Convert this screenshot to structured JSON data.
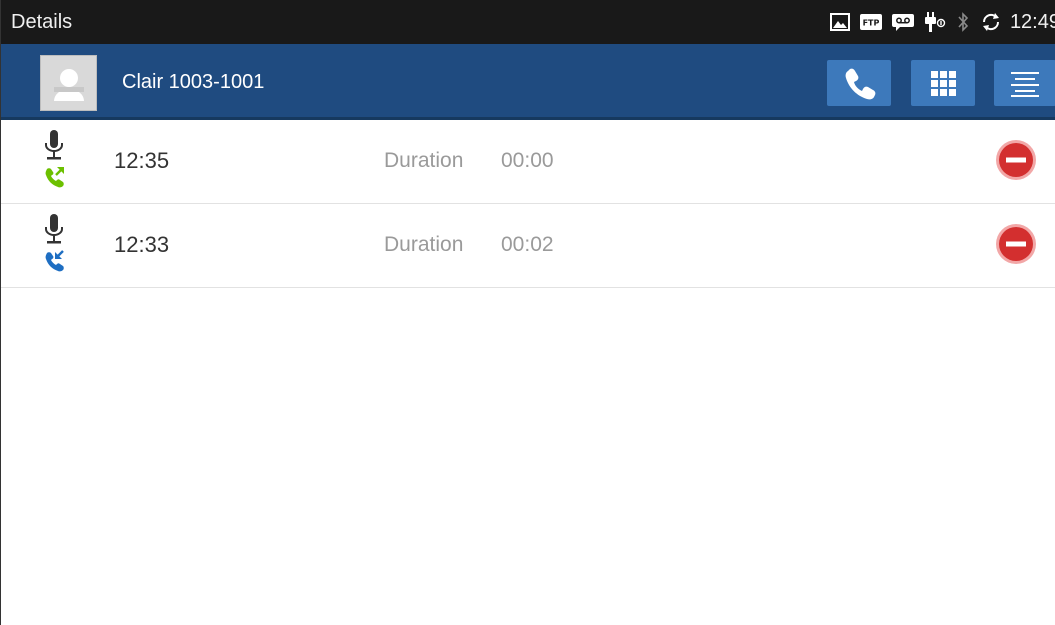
{
  "statusbar": {
    "title": "Details",
    "clock": "12:49",
    "icons": [
      "image-icon",
      "ftp-icon",
      "voicemail-icon",
      "usb-icon",
      "bluetooth-icon",
      "sync-icon"
    ]
  },
  "header": {
    "contact": "Clair  1003-1001",
    "buttons": [
      "call-icon",
      "dialpad-icon",
      "menu-icon"
    ]
  },
  "calls": [
    {
      "time": "12:35",
      "duration_label": "Duration",
      "duration": "00:00",
      "direction": "outgoing",
      "direction_color": "#6cc000"
    },
    {
      "time": "12:33",
      "duration_label": "Duration",
      "duration": "00:02",
      "direction": "incoming",
      "direction_color": "#1e6ec2"
    }
  ],
  "colors": {
    "header": "#1f4b80",
    "button": "#3d79bb",
    "delete": "#d32f2f"
  }
}
